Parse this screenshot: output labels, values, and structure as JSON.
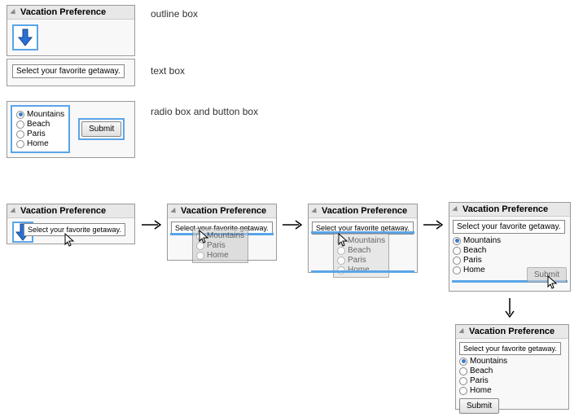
{
  "title": "Vacation Preference",
  "prompt": "Select your favorite getaway.",
  "options": [
    "Mountains",
    "Beach",
    "Paris",
    "Home"
  ],
  "submit": "Submit",
  "labels": {
    "outline": "outline box",
    "text": "text box",
    "radio": "radio box and button box"
  }
}
